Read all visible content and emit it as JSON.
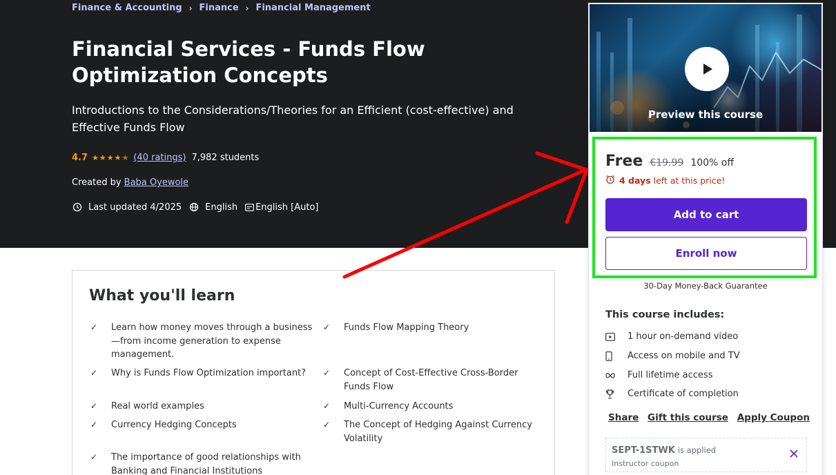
{
  "breadcrumb": [
    "Finance & Accounting",
    "Finance",
    "Financial Management"
  ],
  "course": {
    "title": "Financial Services - Funds Flow Optimization Concepts",
    "subtitle": "Introductions to the Considerations/Theories for an Efficient (cost-effective) and Effective Funds Flow",
    "rating": "4.7",
    "rating_value": 4.7,
    "ratings_count": "(40 ratings)",
    "students": "7,982 students",
    "created_by_label": "Created by",
    "instructor": "Baba Oyewole",
    "last_updated": "Last updated 4/2025",
    "language": "English",
    "captions": "English [Auto]"
  },
  "learn": {
    "title": "What you'll learn",
    "items": [
      "Learn how money moves through a business—from income generation to expense management.",
      "Funds Flow Mapping Theory",
      "Why is Funds Flow Optimization important?",
      "Concept of Cost-Effective Cross-Border Funds Flow",
      "Real world examples",
      "Multi-Currency Accounts",
      "Currency Hedging Concepts",
      "The Concept of Hedging Against Currency Volatility",
      "The importance of good relationships with Banking and Financial Institutions"
    ]
  },
  "sidebar": {
    "preview_label": "Preview this course",
    "price": "Free",
    "original_price": "€19.99",
    "discount": "100% off",
    "timer_days": "4 days",
    "timer_suffix": "left at this price!",
    "add_to_cart": "Add to cart",
    "enroll_now": "Enroll now",
    "guarantee": "30-Day Money-Back Guarantee",
    "includes_title": "This course includes:",
    "includes": [
      {
        "icon": "video-icon",
        "label": "1 hour on-demand video"
      },
      {
        "icon": "mobile-icon",
        "label": "Access on mobile and TV"
      },
      {
        "icon": "infinity-icon",
        "label": "Full lifetime access"
      },
      {
        "icon": "trophy-icon",
        "label": "Certificate of completion"
      }
    ],
    "share": "Share",
    "gift": "Gift this course",
    "apply_coupon": "Apply Coupon",
    "coupon_code": "SEPT-1STWK",
    "coupon_applied": "is applied",
    "coupon_type": "Instructor coupon"
  },
  "colors": {
    "hero_bg": "#1c1d1f",
    "accent": "#5624d0",
    "rating": "#f69c08",
    "link": "#c0c4fc",
    "timer": "#b32d0f",
    "highlight": "#1ee61e",
    "annotation_arrow": "#ff0000"
  }
}
